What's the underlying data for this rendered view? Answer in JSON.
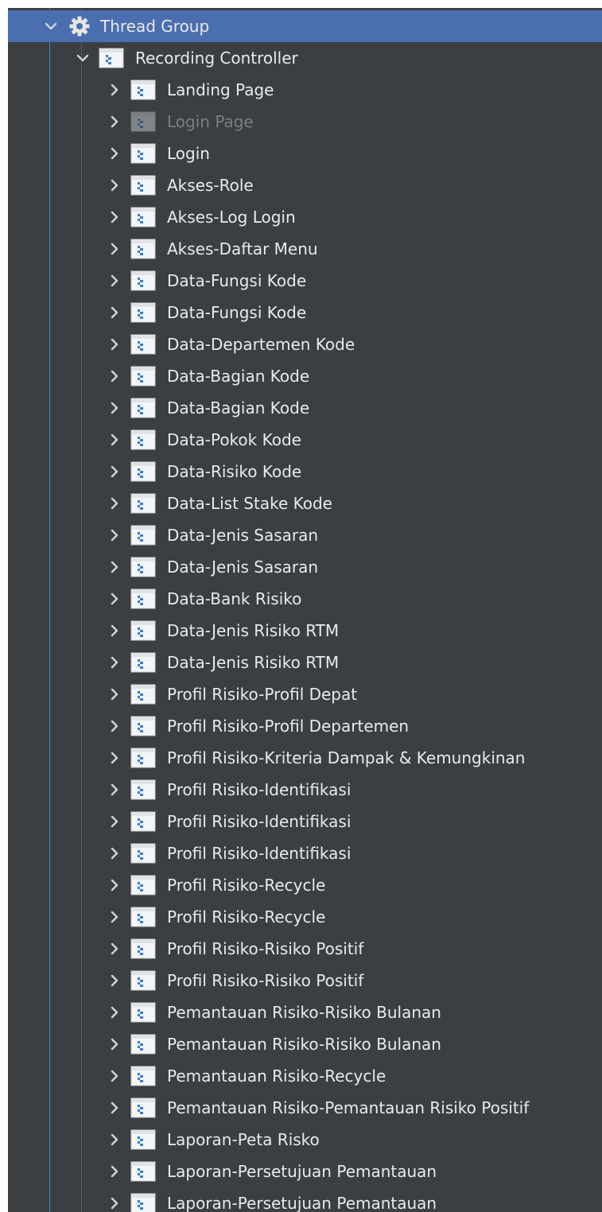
{
  "colors": {
    "panel_bg": "#3c3f41",
    "selection": "#4b6eaf",
    "text": "#e8eaec",
    "disabled_text": "#7b7f83"
  },
  "tree": {
    "root": {
      "label": "Thread Group",
      "icon": "gear-icon",
      "expanded": true,
      "selected": true
    },
    "controller": {
      "label": "Recording Controller",
      "icon": "controller-icon",
      "expanded": true
    },
    "children": [
      {
        "label": "Landing Page",
        "disabled": false
      },
      {
        "label": "Login Page",
        "disabled": true
      },
      {
        "label": "Login",
        "disabled": false
      },
      {
        "label": "Akses-Role",
        "disabled": false
      },
      {
        "label": "Akses-Log Login",
        "disabled": false
      },
      {
        "label": "Akses-Daftar Menu",
        "disabled": false
      },
      {
        "label": "Data-Fungsi Kode",
        "disabled": false
      },
      {
        "label": "Data-Fungsi Kode",
        "disabled": false
      },
      {
        "label": "Data-Departemen Kode",
        "disabled": false
      },
      {
        "label": "Data-Bagian Kode",
        "disabled": false
      },
      {
        "label": "Data-Bagian Kode",
        "disabled": false
      },
      {
        "label": "Data-Pokok Kode",
        "disabled": false
      },
      {
        "label": "Data-Risiko Kode",
        "disabled": false
      },
      {
        "label": "Data-List Stake Kode",
        "disabled": false
      },
      {
        "label": "Data-Jenis Sasaran",
        "disabled": false
      },
      {
        "label": "Data-Jenis Sasaran",
        "disabled": false
      },
      {
        "label": "Data-Bank Risiko",
        "disabled": false
      },
      {
        "label": "Data-Jenis Risiko RTM",
        "disabled": false
      },
      {
        "label": "Data-Jenis Risiko RTM",
        "disabled": false
      },
      {
        "label": "Profil Risiko-Profil Depat",
        "disabled": false
      },
      {
        "label": "Profil Risiko-Profil Departemen",
        "disabled": false
      },
      {
        "label": "Profil Risiko-Kriteria Dampak & Kemungkinan",
        "disabled": false
      },
      {
        "label": "Profil Risiko-Identifikasi",
        "disabled": false
      },
      {
        "label": "Profil Risiko-Identifikasi",
        "disabled": false
      },
      {
        "label": "Profil Risiko-Identifikasi",
        "disabled": false
      },
      {
        "label": "Profil Risiko-Recycle",
        "disabled": false
      },
      {
        "label": "Profil Risiko-Recycle",
        "disabled": false
      },
      {
        "label": "Profil Risiko-Risiko Positif",
        "disabled": false
      },
      {
        "label": "Profil Risiko-Risiko Positif",
        "disabled": false
      },
      {
        "label": "Pemantauan Risiko-Risiko Bulanan",
        "disabled": false
      },
      {
        "label": "Pemantauan Risiko-Risiko Bulanan",
        "disabled": false
      },
      {
        "label": "Pemantauan Risiko-Recycle",
        "disabled": false
      },
      {
        "label": "Pemantauan Risiko-Pemantauan Risiko Positif",
        "disabled": false
      },
      {
        "label": "Laporan-Peta Risko",
        "disabled": false
      },
      {
        "label": "Laporan-Persetujuan Pemantauan",
        "disabled": false
      },
      {
        "label": "Laporan-Persetujuan Pemantauan",
        "disabled": false
      }
    ]
  }
}
